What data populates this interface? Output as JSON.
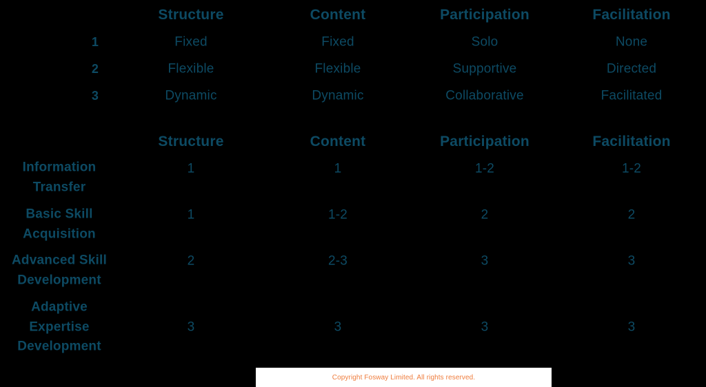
{
  "colors": {
    "background": "#000000",
    "text": "#0d4a63",
    "footer_band": "#ffffff",
    "footer_text": "#ef7c3c"
  },
  "dimension_scale_table": {
    "columns": [
      "Structure",
      "Content",
      "Participation",
      "Facilitation"
    ],
    "levels": [
      "1",
      "2",
      "3"
    ],
    "rows": [
      {
        "level": "1",
        "values": [
          "Fixed",
          "Fixed",
          "Solo",
          "None"
        ]
      },
      {
        "level": "2",
        "values": [
          "Flexible",
          "Flexible",
          "Supportive",
          "Directed"
        ]
      },
      {
        "level": "3",
        "values": [
          "Dynamic",
          "Dynamic",
          "Collaborative",
          "Facilitated"
        ]
      }
    ]
  },
  "learning_outcome_table": {
    "columns": [
      "Structure",
      "Content",
      "Participation",
      "Facilitation"
    ],
    "rows": [
      {
        "label": "Information\nTransfer",
        "values": [
          "1",
          "1",
          "1-2",
          "1-2"
        ]
      },
      {
        "label": "Basic Skill\nAcquisition",
        "values": [
          "1",
          "1-2",
          "2",
          "2"
        ]
      },
      {
        "label": "Advanced Skill\nDevelopment",
        "values": [
          "2",
          "2-3",
          "3",
          "3"
        ]
      },
      {
        "label": "Adaptive\nExpertise\nDevelopment",
        "values": [
          "3",
          "3",
          "3",
          "3"
        ]
      }
    ]
  },
  "footer": {
    "copyright": "Copyright Fosway Limited. All rights reserved."
  }
}
